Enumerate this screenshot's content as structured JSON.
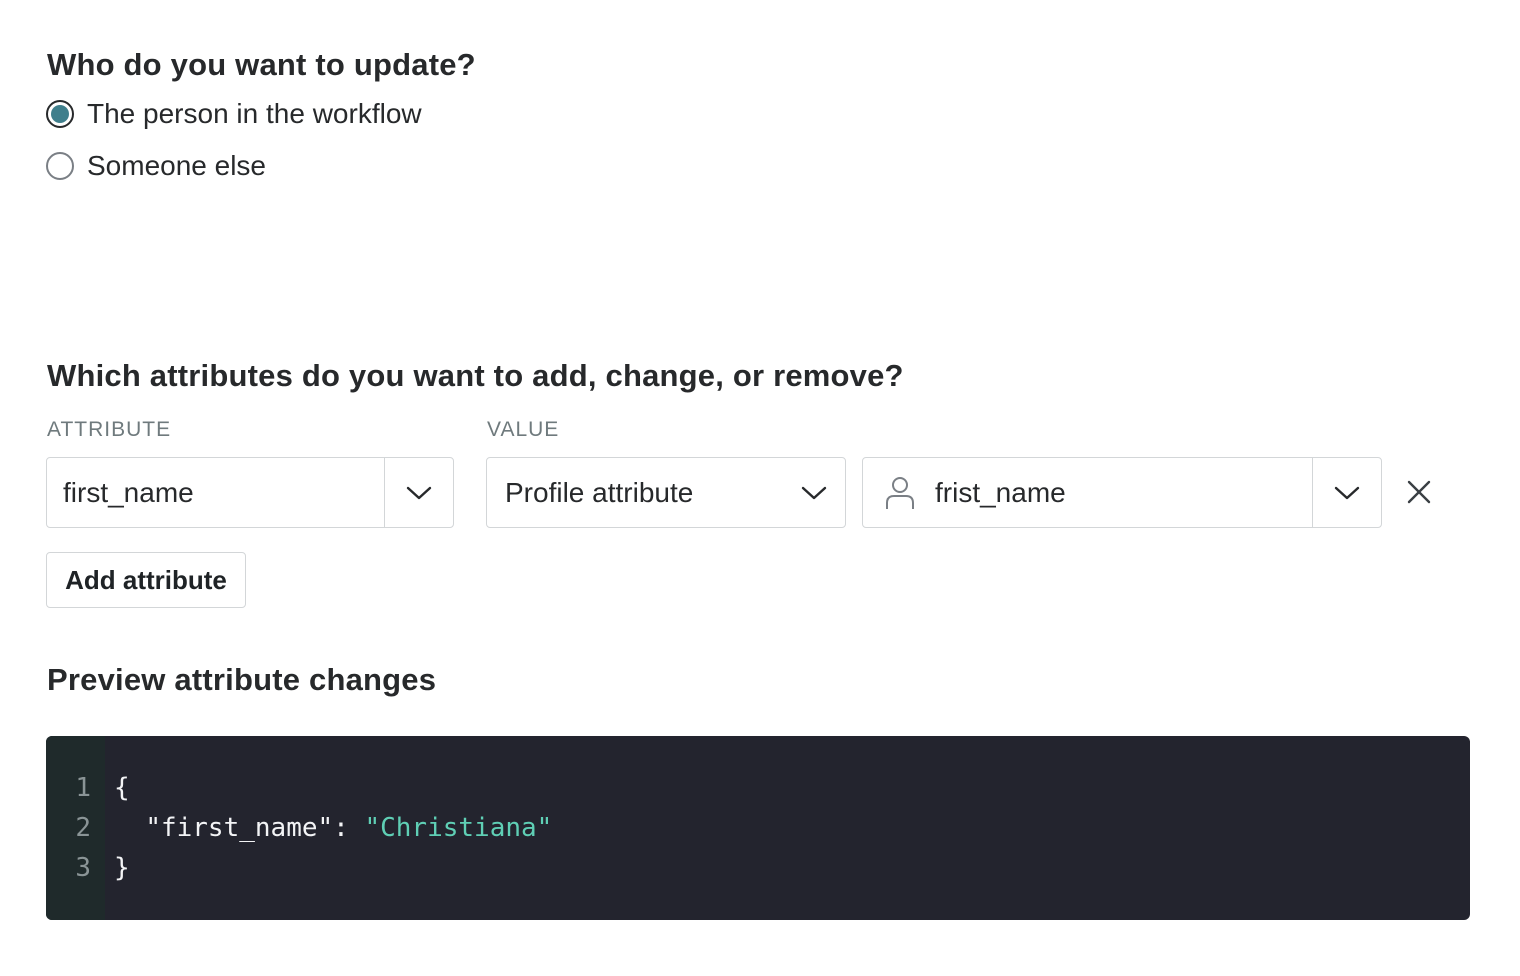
{
  "who_section": {
    "title": "Who do you want to update?",
    "options": [
      {
        "label": "The person in the workflow",
        "selected": true
      },
      {
        "label": "Someone else",
        "selected": false
      }
    ]
  },
  "attributes_section": {
    "title": "Which attributes do you want to add, change, or remove?",
    "attribute_column_label": "ATTRIBUTE",
    "value_column_label": "VALUE",
    "row": {
      "attribute": "first_name",
      "value_type": "Profile attribute",
      "profile_attribute": "frist_name"
    },
    "add_button_label": "Add attribute"
  },
  "preview_section": {
    "title": "Preview attribute changes",
    "lines": [
      {
        "number": "1",
        "text": "{"
      },
      {
        "number": "2",
        "key": "\"first_name\"",
        "sep": ": ",
        "value": "\"Christiana\""
      },
      {
        "number": "3",
        "text": "}"
      }
    ]
  },
  "colors": {
    "radio_selected": "#3f7f8c",
    "code_background": "#23242e",
    "code_string": "#5fcfb5"
  },
  "icons": [
    "chevron-down-icon",
    "person-icon",
    "close-icon"
  ]
}
